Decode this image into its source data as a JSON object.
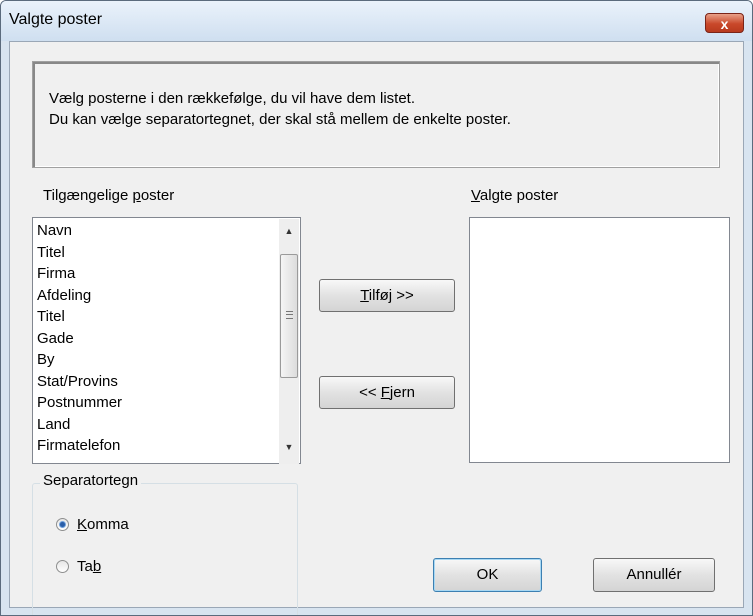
{
  "window": {
    "title": "Valgte poster",
    "close_label": "x"
  },
  "info": {
    "line1": "Vælg posterne i den rækkefølge, du vil have dem listet.",
    "line2": "Du kan vælge separatortegnet, der skal stå mellem de enkelte poster."
  },
  "available": {
    "label_pre": "Tilgængelige ",
    "label_key": "p",
    "label_post": "oster",
    "items": [
      "Navn",
      "Titel",
      "Firma",
      "Afdeling",
      "Titel",
      "Gade",
      "By",
      "Stat/Provins",
      "Postnummer",
      "Land",
      "Firmatelefon"
    ]
  },
  "selected": {
    "label_key": "V",
    "label_post": "algte poster",
    "items": []
  },
  "buttons": {
    "add_key": "T",
    "add_post": "ilføj >>",
    "remove_pre": "<< ",
    "remove_key": "F",
    "remove_post": "jern",
    "ok": "OK",
    "cancel": "Annullér"
  },
  "separator": {
    "title": "Separatortegn",
    "options": [
      {
        "key": "K",
        "post": "omma",
        "checked": true
      },
      {
        "pre": "Ta",
        "key": "b",
        "checked": false
      }
    ]
  }
}
